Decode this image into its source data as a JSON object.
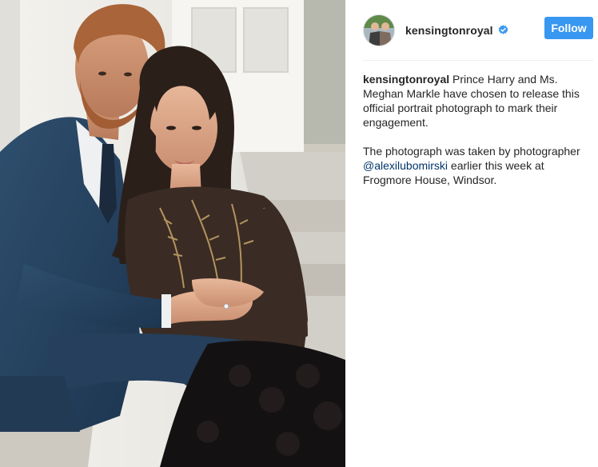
{
  "profile": {
    "username": "kensingtonroyal",
    "verified": true,
    "follow_label": "Follow"
  },
  "caption": {
    "username": "kensingtonroyal",
    "text_1": " Prince Harry and Ms. Meghan Markle have chosen to release this official portrait photograph to mark their engagement.",
    "text_2_before": "The photograph was taken by photographer ",
    "mention": "@alexilubomirski",
    "text_2_after": " earlier this week at Frogmore House, Windsor."
  },
  "colors": {
    "follow_button": "#3897f0",
    "mention_link": "#003569",
    "verified_badge": "#3897f0",
    "text": "#262626"
  },
  "icons": {
    "verified": "verified-badge-icon"
  }
}
